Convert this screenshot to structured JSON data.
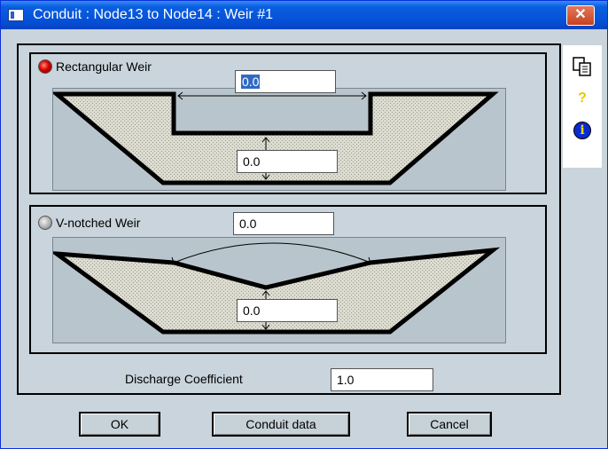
{
  "window": {
    "title": "Conduit : Node13 to Node14 : Weir #1",
    "close_label": "✕"
  },
  "rect_weir": {
    "label": "Rectangular Weir",
    "width_value": "0.0",
    "height_value": "0.0"
  },
  "v_weir": {
    "label": "V-notched Weir",
    "width_value": "0.0",
    "height_value": "0.0"
  },
  "discharge": {
    "label": "Discharge Coefficient",
    "value": "1.0"
  },
  "buttons": {
    "ok": "OK",
    "conduit_data": "Conduit data",
    "cancel": "Cancel"
  },
  "sidebar": {
    "icons": [
      "copy-icon",
      "help-icon",
      "info-icon"
    ],
    "help_glyph": "?",
    "info_glyph": "i"
  },
  "colors": {
    "accent": "#0a5fe0",
    "background": "#c9d4dc",
    "panel": "#b8c5cc",
    "selection": "#316ac5"
  }
}
